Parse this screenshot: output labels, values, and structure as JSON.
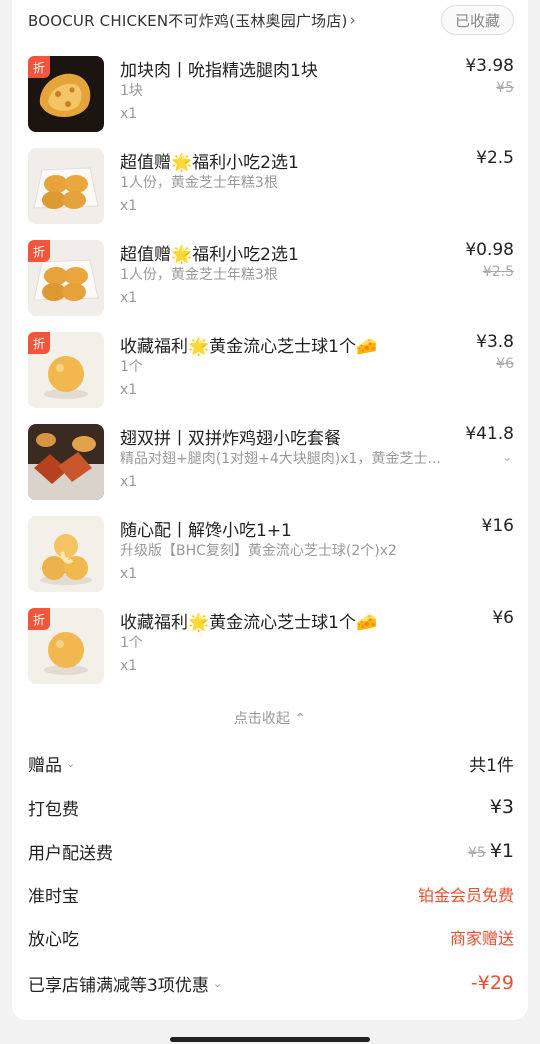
{
  "store": {
    "name": "BOOCUR CHICKEN不可炸鸡(玉林奥园广场店)",
    "chevron": "›",
    "favorite_label": "已收藏"
  },
  "discount_badge": "折",
  "items": [
    {
      "name": "加块肉丨吮指精选腿肉1块",
      "spec": "1块",
      "qty": "x1",
      "price": "¥3.98",
      "original": "¥5",
      "discount": true
    },
    {
      "name": "超值赠🌟福利小吃2选1",
      "spec": "1人份，黄金芝士年糕3根",
      "qty": "x1",
      "price": "¥2.5",
      "original": "",
      "discount": false
    },
    {
      "name": "超值赠🌟福利小吃2选1",
      "spec": "1人份，黄金芝士年糕3根",
      "qty": "x1",
      "price": "¥0.98",
      "original": "¥2.5",
      "discount": true
    },
    {
      "name": "收藏福利🌟黄金流心芝士球1个🧀",
      "spec": "1个",
      "qty": "x1",
      "price": "¥3.8",
      "original": "¥6",
      "discount": true
    },
    {
      "name": "翅双拼丨双拼炸鸡翅小吃套餐",
      "spec": "精品对翅+腿肉(1对翅+4大块腿肉)x1，黄金芝士...",
      "qty": "x1",
      "price": "¥41.8",
      "original": "",
      "discount": false
    },
    {
      "name": "随心配丨解馋小吃1+1",
      "spec": "升级版【BHC复刻】黄金流心芝士球(2个)x2",
      "qty": "x1",
      "price": "¥16",
      "original": "",
      "discount": false
    },
    {
      "name": "收藏福利🌟黄金流心芝士球1个🧀",
      "spec": "1个",
      "qty": "x1",
      "price": "¥6",
      "original": "",
      "discount": true
    }
  ],
  "collapse_label": "点击收起 ⌃",
  "expand_icon": "⌄",
  "summary": {
    "gift": {
      "label": "赠品",
      "value": "共1件"
    },
    "packing": {
      "label": "打包费",
      "value": "¥3"
    },
    "delivery": {
      "label": "用户配送费",
      "original": "¥5",
      "value": "¥1"
    },
    "ontime": {
      "label": "准时宝",
      "value": "铂金会员免费"
    },
    "safe": {
      "label": "放心吃",
      "value": "商家赠送"
    },
    "discount": {
      "label": "已享店铺满减等3项优惠",
      "value": "-¥29"
    }
  },
  "colors": {
    "accent_red": "#f04d2e",
    "badge": "#f2553a",
    "muted": "#999999"
  }
}
